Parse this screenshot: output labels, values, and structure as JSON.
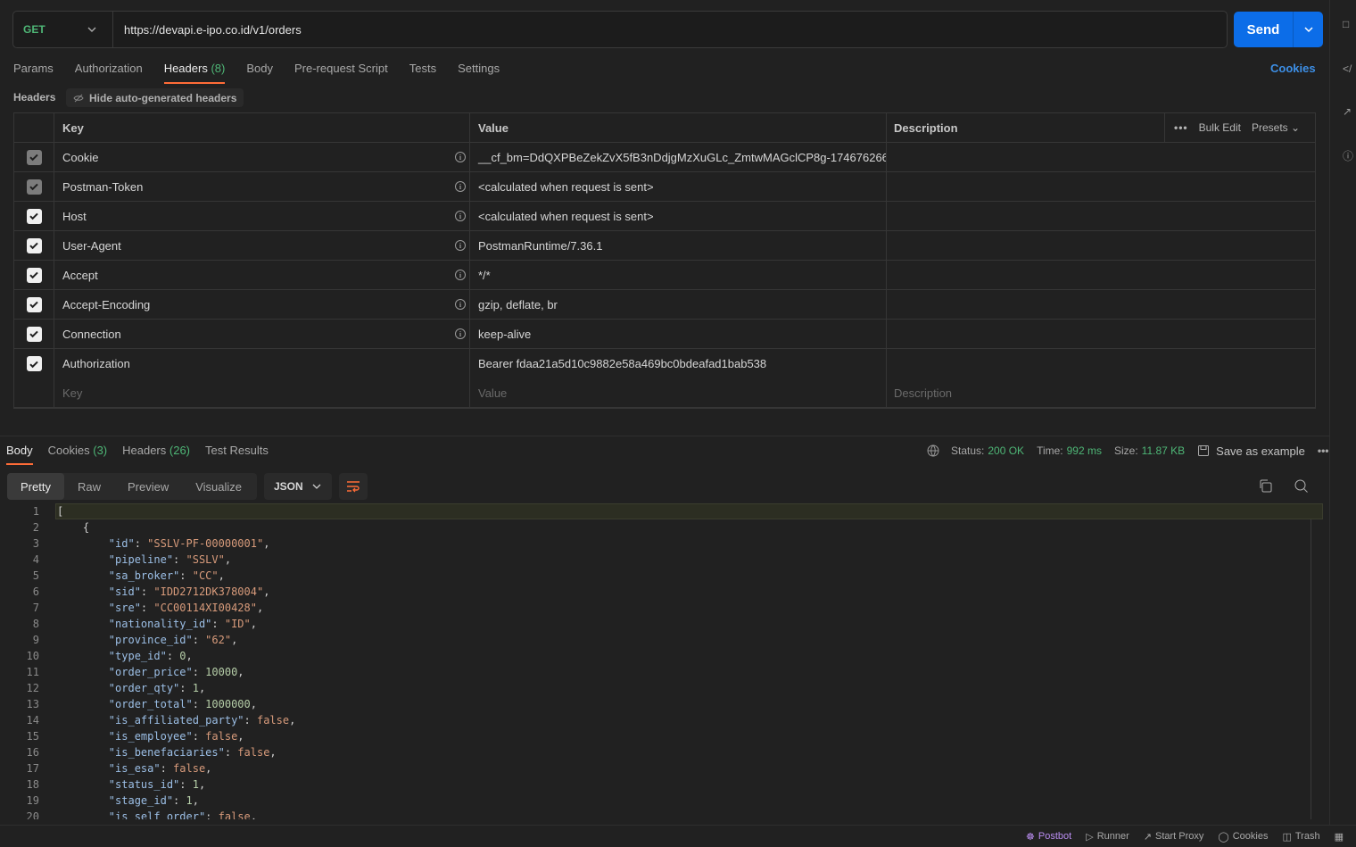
{
  "request": {
    "method": "GET",
    "url": "https://devapi.e-ipo.co.id/v1/orders",
    "send_label": "Send"
  },
  "tabs": [
    {
      "label": "Params",
      "count": ""
    },
    {
      "label": "Authorization",
      "count": ""
    },
    {
      "label": "Headers",
      "count": "(8)"
    },
    {
      "label": "Body",
      "count": ""
    },
    {
      "label": "Pre-request Script",
      "count": ""
    },
    {
      "label": "Tests",
      "count": ""
    },
    {
      "label": "Settings",
      "count": ""
    }
  ],
  "cookies_link": "Cookies",
  "headers_section": {
    "label": "Headers",
    "hide_auto": "Hide auto-generated headers",
    "columns": {
      "key": "Key",
      "value": "Value",
      "description": "Description"
    },
    "actions": {
      "bulk_edit": "Bulk Edit",
      "presets": "Presets"
    },
    "rows": [
      {
        "key": "Cookie",
        "value": "__cf_bm=DdQXPBeZekZvX5fB3nDdjgMzXuGLc_ZmtwMAGclCP8g-174676266...",
        "state": "dim",
        "info": true
      },
      {
        "key": "Postman-Token",
        "value": "<calculated when request is sent>",
        "state": "dim",
        "info": true
      },
      {
        "key": "Host",
        "value": "<calculated when request is sent>",
        "state": "on",
        "info": true
      },
      {
        "key": "User-Agent",
        "value": "PostmanRuntime/7.36.1",
        "state": "on",
        "info": true
      },
      {
        "key": "Accept",
        "value": "*/*",
        "state": "on",
        "info": true
      },
      {
        "key": "Accept-Encoding",
        "value": "gzip, deflate, br",
        "state": "on",
        "info": true
      },
      {
        "key": "Connection",
        "value": "keep-alive",
        "state": "on",
        "info": true
      },
      {
        "key": "Authorization",
        "value": "Bearer fdaa21a5d10c9882e58a469bc0bdeafad1bab538",
        "state": "on",
        "info": false
      }
    ],
    "placeholders": {
      "key": "Key",
      "value": "Value",
      "description": "Description"
    }
  },
  "response": {
    "tabs": [
      {
        "label": "Body",
        "count": ""
      },
      {
        "label": "Cookies",
        "count": "(3)"
      },
      {
        "label": "Headers",
        "count": "(26)"
      },
      {
        "label": "Test Results",
        "count": ""
      }
    ],
    "status_label": "Status:",
    "status_value": "200 OK",
    "time_label": "Time:",
    "time_value": "992 ms",
    "size_label": "Size:",
    "size_value": "11.87 KB",
    "save_example": "Save as example",
    "views": [
      "Pretty",
      "Raw",
      "Preview",
      "Visualize"
    ],
    "format": "JSON",
    "code_lines": [
      "[",
      "    {",
      "        \"id\": \"SSLV-PF-00000001\",",
      "        \"pipeline\": \"SSLV\",",
      "        \"sa_broker\": \"CC\",",
      "        \"sid\": \"IDD2712DK378004\",",
      "        \"sre\": \"CC00114XI00428\",",
      "        \"nationality_id\": \"ID\",",
      "        \"province_id\": \"62\",",
      "        \"type_id\": 0,",
      "        \"order_price\": 10000,",
      "        \"order_qty\": 1,",
      "        \"order_total\": 1000000,",
      "        \"is_affiliated_party\": false,",
      "        \"is_employee\": false,",
      "        \"is_benefaciaries\": false,",
      "        \"is_esa\": false,",
      "        \"status_id\": 1,",
      "        \"stage_id\": 1,",
      "        \"is_self_order\": false,"
    ]
  },
  "footer": [
    "Postbot",
    "Runner",
    "Start Proxy",
    "Cookies",
    "Trash"
  ]
}
